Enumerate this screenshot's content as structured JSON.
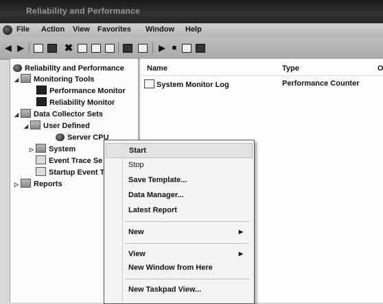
{
  "window": {
    "title": "Reliability and Performance"
  },
  "menu": [
    "File",
    "Action",
    "View",
    "Favorites",
    "Window",
    "Help"
  ],
  "toolbar_icons": [
    "back-arrow-icon",
    "forward-arrow-icon",
    "up-folder-icon",
    "show-hide-tree-icon",
    "delete-icon",
    "properties-icon",
    "refresh-icon",
    "export-icon",
    "help-icon",
    "console-icon",
    "start-icon",
    "stop-icon",
    "new-icon",
    "properties-alt-icon"
  ],
  "tree": {
    "root": "Reliability and Performance",
    "monitoring_tools": "Monitoring Tools",
    "performance_monitor": "Performance Monitor",
    "reliability_monitor": "Reliability Monitor",
    "data_collector_sets": "Data Collector Sets",
    "user_defined": "User Defined",
    "server_cpu": "Server CPU",
    "system": "System",
    "event_trace": "Event Trace Se",
    "startup_event": "Startup Event T",
    "reports": "Reports"
  },
  "list": {
    "columns": [
      "Name",
      "Type",
      "O"
    ],
    "rows": [
      {
        "name": "System Monitor Log",
        "type": "Performance Counter"
      }
    ]
  },
  "context_menu": {
    "start": "Start",
    "stop": "Stop",
    "save_template": "Save Template...",
    "data_manager": "Data Manager...",
    "latest_report": "Latest Report",
    "new": "New",
    "view": "View",
    "new_window": "New Window from Here",
    "new_taskpad": "New Taskpad View..."
  }
}
